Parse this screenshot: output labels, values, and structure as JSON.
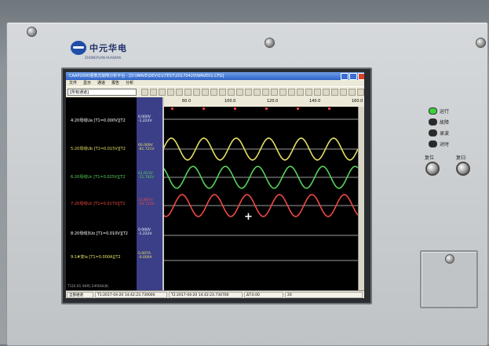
{
  "device": {
    "brand_name": "中元华电",
    "brand_sub": "ZHONGYUAN HUADIAN",
    "leds": [
      {
        "label": "运行",
        "color": "#3ad13a"
      },
      {
        "label": "故障",
        "color": "#2a2a2a"
      },
      {
        "label": "录波",
        "color": "#2a2a2a"
      },
      {
        "label": "对时",
        "color": "#2a2a2a"
      }
    ],
    "buttons": [
      {
        "label": "复位"
      },
      {
        "label": "复归"
      }
    ]
  },
  "window": {
    "title": "CAAP2000便携式故障分析平台 - [D:\\WAVE\\DEV\\01\\TEST\\20170420\\WAVE01.CFG]",
    "menu": [
      "文件",
      "显示",
      "通道",
      "报告",
      "分析"
    ],
    "combo_value": "[所有通道]",
    "ruler_ticks": [
      "60.0",
      "100.0",
      "120.0",
      "140.0",
      "160.0"
    ]
  },
  "channels": [
    {
      "label": "4:20母线Ua [T1=0.000V][T2",
      "v1": "0.000V",
      "v2": "-1.222V",
      "color": "#ffffff"
    },
    {
      "label": "5:20母线Ub [T1=0.015V][T2",
      "v1": "60.009V",
      "v2": "-81.721V",
      "color": "#e6e063"
    },
    {
      "label": "6:20母线Uc [T1=0.025V][T2",
      "v1": "61.653V",
      "v2": "-51.782V",
      "color": "#58d15a"
    },
    {
      "label": "7:20母线Uc [T1=0.017V][T2",
      "v1": "52.867V",
      "v2": "-50.125V",
      "color": "#ee4a44"
    },
    {
      "label": "8:20母线3Uo [T1=0.010V][T2",
      "v1": "0.000V",
      "v2": "-1.222V",
      "color": "#ffffff"
    },
    {
      "label": "9:1#变Ia [T1=0.000A][T2",
      "v1": "0.007A",
      "v2": "-0.000A",
      "color": "#e6e063"
    }
  ],
  "status": {
    "cursor": "T1[0.01 949] 2#004(8)",
    "fields": [
      "全部通道",
      "T1:2017-04-20 14:42:23.730000",
      "T2:2017-04-20 14:42:23.730700",
      "ΔT:0.00",
      "20"
    ]
  }
}
